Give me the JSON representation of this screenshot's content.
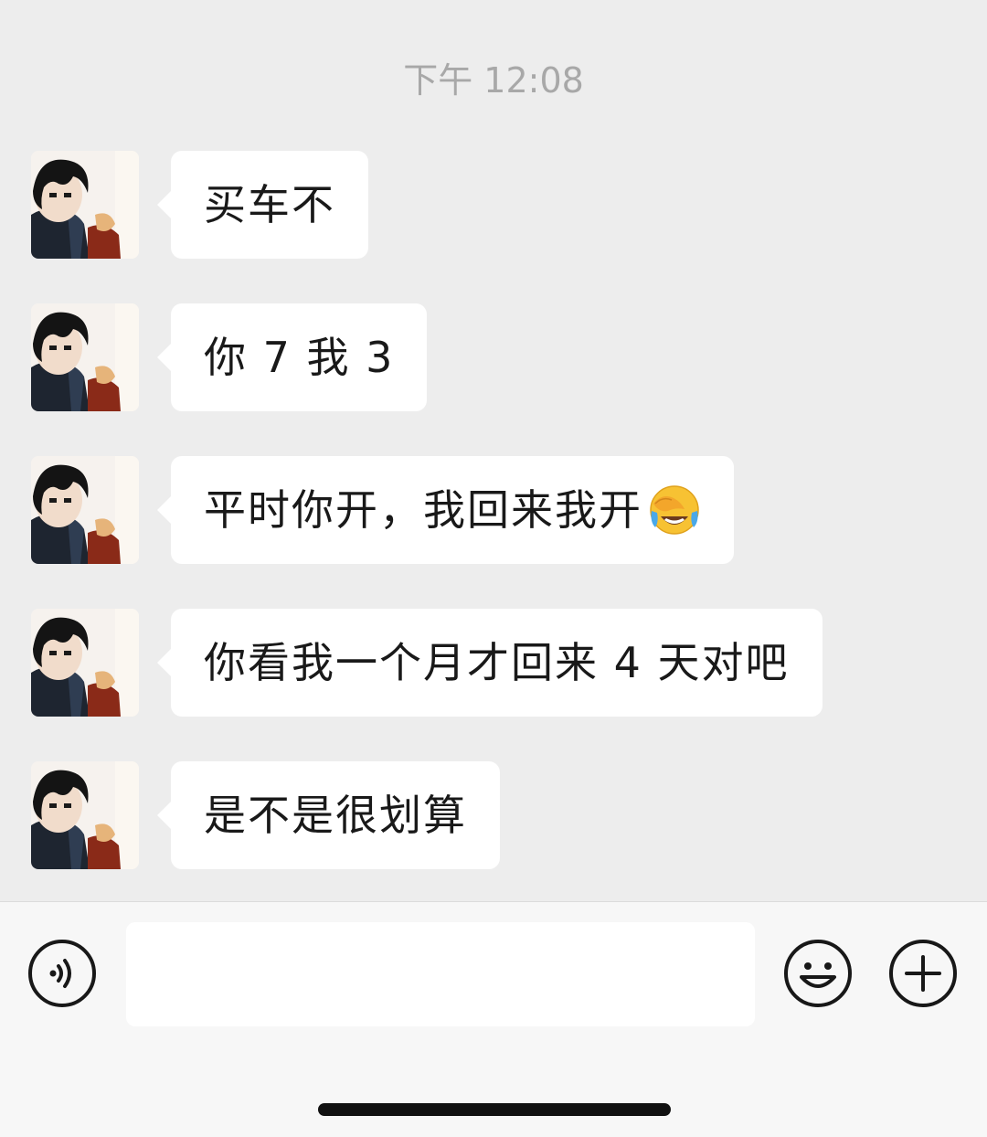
{
  "chat": {
    "timestamp": "下午 12:08",
    "messages": [
      {
        "text": "买车不",
        "emoji": ""
      },
      {
        "text": "你 7 我 3",
        "emoji": ""
      },
      {
        "text": "平时你开，我回来我开",
        "emoji": "face-with-tears-of-joy-covering-eyes-icon"
      },
      {
        "text": "你看我一个月才回来 4 天对吧",
        "emoji": ""
      },
      {
        "text": "是不是很划算",
        "emoji": ""
      }
    ]
  },
  "input_bar": {
    "message_value": "",
    "icons": {
      "voice": "voice-input-icon",
      "emoji": "emoji-smiley-icon",
      "more": "plus-icon"
    }
  },
  "colors": {
    "chat_background": "#ededed",
    "bubble": "#ffffff",
    "timestamp_text": "#a8a8a8",
    "message_text": "#191919",
    "input_bar": "#f7f7f7"
  }
}
